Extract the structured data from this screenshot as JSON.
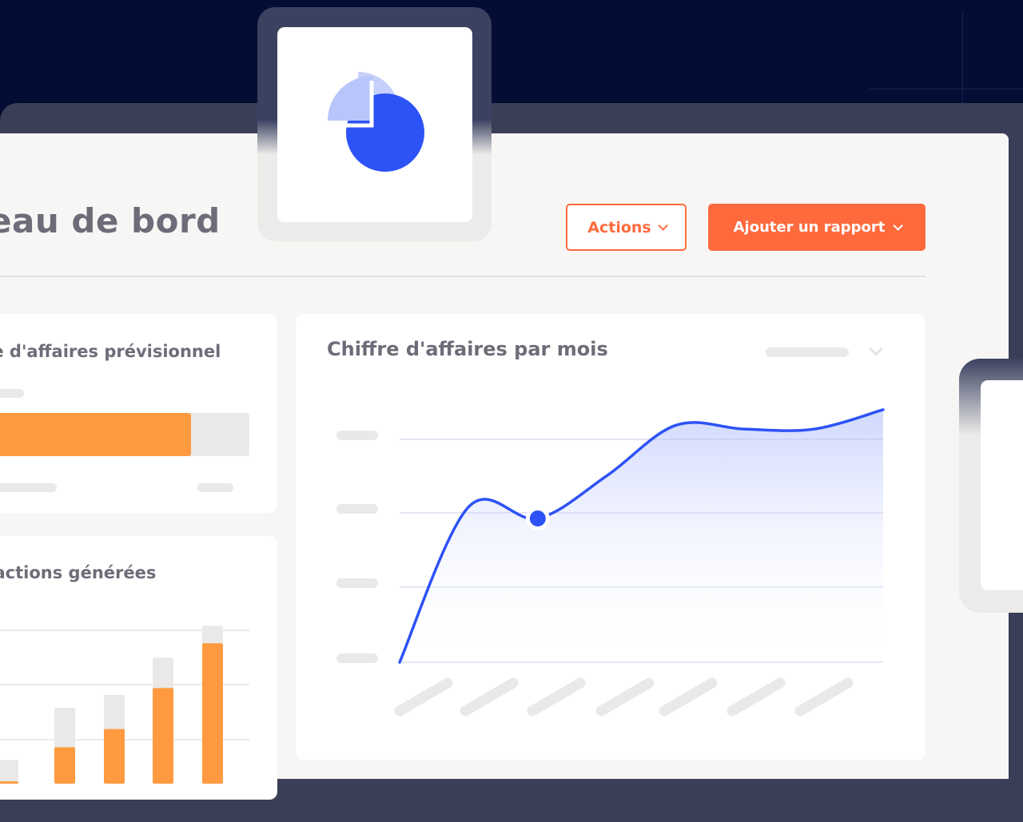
{
  "header": {
    "title": "eau de bord",
    "actions_label": "Actions",
    "add_report_label": "Ajouter un rapport"
  },
  "cards": {
    "forecast_title": "re d'affaires prévisionnel",
    "forecast_progress": 0.78,
    "transactions_title": "sactions générées",
    "monthly_title": "Chiffre d'affaires par mois"
  },
  "icons": {
    "tile": "pie-chart-icon",
    "dropdown": "chevron-down-icon"
  },
  "colors": {
    "accent": "#ff6a3d",
    "chart_line": "#2d52f5",
    "bar": "#ff9a40",
    "bar_track": "#ebe9e8",
    "background": "#040d33"
  },
  "chart_data": [
    {
      "type": "bar",
      "title": "sactions générées",
      "categories": [
        "",
        "",
        "",
        "",
        ""
      ],
      "series": [
        {
          "values": [
            3,
            48,
            72,
            126,
            185
          ]
        },
        {
          "values": [
            31,
            100,
            117,
            166,
            208
          ]
        }
      ],
      "grid": true
    },
    {
      "type": "area",
      "title": "Chiffre d'affaires par mois",
      "x": [
        0,
        1,
        2,
        3,
        4,
        5,
        6,
        7
      ],
      "values": [
        0,
        2.0,
        1.85,
        2.4,
        3.05,
        3.0,
        3.0,
        3.25
      ],
      "highlight_index": 2,
      "ylim": [
        0,
        3.3
      ],
      "grid": true
    }
  ]
}
